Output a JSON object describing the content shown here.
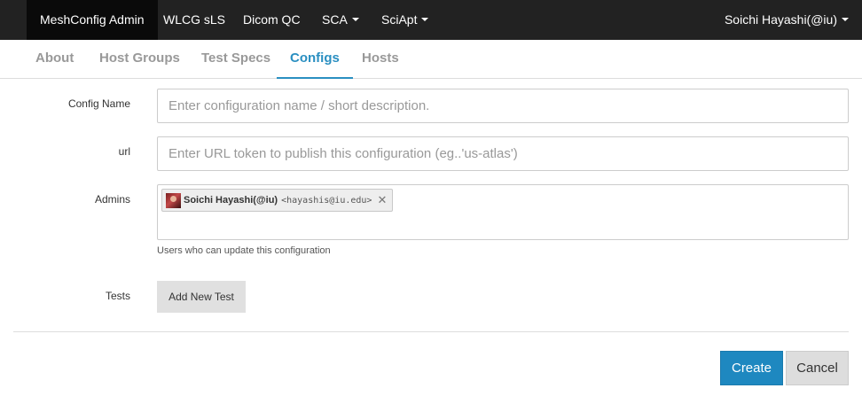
{
  "navbar": {
    "items": [
      {
        "label": "MeshConfig Admin",
        "active": true
      },
      {
        "label": "WLCG sLS"
      },
      {
        "label": "Dicom QC"
      },
      {
        "label": "SCA",
        "dropdown": true
      },
      {
        "label": "SciApt",
        "dropdown": true
      }
    ],
    "user": "Soichi Hayashi(@iu)"
  },
  "tabs": [
    {
      "label": "About"
    },
    {
      "label": "Host Groups"
    },
    {
      "label": "Test Specs"
    },
    {
      "label": "Configs",
      "active": true
    },
    {
      "label": "Hosts"
    }
  ],
  "form": {
    "config_name": {
      "label": "Config Name",
      "placeholder": "Enter configuration name / short description.",
      "value": ""
    },
    "url": {
      "label": "url",
      "placeholder": "Enter URL token to publish this configuration (eg..'us-atlas')",
      "value": ""
    },
    "admins": {
      "label": "Admins",
      "selected": [
        {
          "name": "Soichi Hayashi(@iu)",
          "email": "<hayashis@iu.edu>"
        }
      ],
      "help": "Users who can update this configuration"
    },
    "tests": {
      "label": "Tests",
      "add_button": "Add New Test"
    }
  },
  "actions": {
    "create": "Create",
    "cancel": "Cancel"
  },
  "colors": {
    "navbar_bg": "#222222",
    "accent": "#2a8fc1",
    "primary_button": "#1e88c0"
  }
}
